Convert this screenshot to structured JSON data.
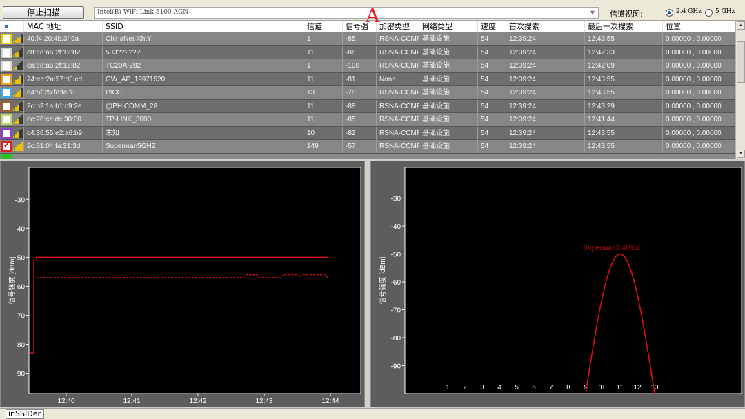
{
  "toolbar": {
    "scan_button": "停止扫描",
    "adapter": "Intel(R) WiFi Link 5100 AGN",
    "channel_view_label": "信道视图:",
    "band_24": "2.4 GHz",
    "band_5": "5 GHz",
    "selected_band": "2.4 GHz"
  },
  "cursor_letter": "A",
  "table": {
    "columns": [
      "MAC 地址",
      "SSID",
      "信道",
      "信号强",
      "加密类型",
      "网络类型",
      "速度",
      "首次搜索",
      "最后一次搜索",
      "位置"
    ],
    "rows": [
      {
        "color": "#f0d000",
        "checked": false,
        "bars": 4,
        "mac": "40:f4:20:4b:3f:9a",
        "ssid": "ChinaNet-XhtY",
        "channel": "1",
        "rssi": "-85",
        "security": "RSNA-CCMP",
        "nettype": "基础设施",
        "speed": "54",
        "first": "12:39:24",
        "last": "12:43:55",
        "location": "0.00000 , 0.00000"
      },
      {
        "color": "#d0d0d0",
        "checked": false,
        "bars": 3,
        "mac": "c8:ee:a6:2f:12:82",
        "ssid": "503??????",
        "channel": "11",
        "rssi": "-86",
        "security": "RSNA-CCMP",
        "nettype": "基础设施",
        "speed": "54",
        "first": "12:39:24",
        "last": "12:42:33",
        "location": "0.00000 , 0.00000"
      },
      {
        "color": "#d8d8d8",
        "checked": false,
        "bars": 2,
        "mac": "ca:ee:a6:2f:12:82",
        "ssid": "TC20A-282",
        "channel": "1",
        "rssi": "-100",
        "security": "RSNA-CCMP",
        "nettype": "基础设施",
        "speed": "54",
        "first": "12:39:24",
        "last": "12:42:09",
        "location": "0.00000 , 0.00000"
      },
      {
        "color": "#f0a020",
        "checked": false,
        "bars": 4,
        "mac": "74:ee:2a:57:d8:cd",
        "ssid": "GW_AP_19971520",
        "channel": "11",
        "rssi": "-81",
        "security": "None",
        "nettype": "基础设施",
        "speed": "54",
        "first": "12:39:24",
        "last": "12:43:55",
        "location": "0.00000 , 0.00000"
      },
      {
        "color": "#40a8e0",
        "checked": false,
        "bars": 4,
        "mac": "d4:5f:25:fd:fe:f8",
        "ssid": "PICC",
        "channel": "13",
        "rssi": "-78",
        "security": "RSNA-CCMP",
        "nettype": "基础设施",
        "speed": "54",
        "first": "12:39:24",
        "last": "12:43:55",
        "location": "0.00000 , 0.00000"
      },
      {
        "color": "#a06030",
        "checked": false,
        "bars": 3,
        "mac": "2c:b2:1a:b1:c9:2e",
        "ssid": "@PHICOMM_28",
        "channel": "11",
        "rssi": "-88",
        "security": "RSNA-CCMP",
        "nettype": "基础设施",
        "speed": "54",
        "first": "12:39:24",
        "last": "12:43:29",
        "location": "0.00000 , 0.00000"
      },
      {
        "color": "#b8d870",
        "checked": false,
        "bars": 3,
        "mac": "ec:26:ca:dc:30:00",
        "ssid": "TP-LINK_3000",
        "channel": "11",
        "rssi": "-85",
        "security": "RSNA-CCMP",
        "nettype": "基础设施",
        "speed": "54",
        "first": "12:39:24",
        "last": "12:41:44",
        "location": "0.00000 , 0.00000"
      },
      {
        "color": "#9040d0",
        "checked": false,
        "bars": 3,
        "mac": "c4:36:55:e2:a6:b9",
        "ssid": "未知",
        "channel": "10",
        "rssi": "-82",
        "security": "RSNA-CCMP",
        "nettype": "基础设施",
        "speed": "54",
        "first": "12:39:24",
        "last": "12:43:55",
        "location": "0.00000 , 0.00000"
      },
      {
        "color": "#e02020",
        "checked": true,
        "bars": 5,
        "mac": "2c:61:04:fa:31:3d",
        "ssid": "Superman5GHZ",
        "channel": "149",
        "rssi": "-57",
        "security": "RSNA-CCMP",
        "nettype": "基础设施",
        "speed": "54",
        "first": "12:39:24",
        "last": "12:43:55",
        "location": "0.00000 , 0.00000"
      }
    ]
  },
  "time_chart": {
    "ylabel": "信号强度 [dBm]",
    "yticks": [
      -30,
      -40,
      -50,
      -60,
      -70,
      -80,
      -90
    ],
    "ylim": [
      -97,
      -19
    ],
    "xticks": [
      "12:40",
      "12:41",
      "12:42",
      "12:43",
      "12:44"
    ],
    "series_color": "#e01010"
  },
  "channel_chart": {
    "ylabel": "信号强度 [dBm]",
    "yticks": [
      -30,
      -40,
      -50,
      -60,
      -70,
      -80,
      -90
    ],
    "ylim": [
      -100,
      -19
    ],
    "xticks": [
      "1",
      "2",
      "3",
      "4",
      "5",
      "6",
      "7",
      "8",
      "9",
      "10",
      "11",
      "12",
      "13"
    ],
    "network_label": "Superman2.4GHZ",
    "center_channel": 11,
    "peak_dbm": -50,
    "series_color": "#e01010"
  },
  "statusbar": {
    "tab": "inSSIDer"
  }
}
